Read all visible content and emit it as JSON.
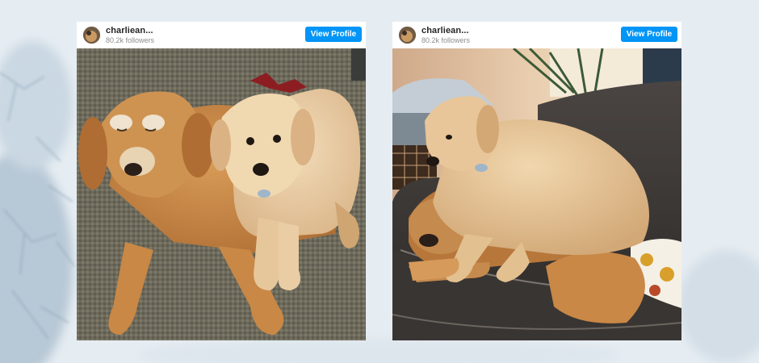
{
  "posts": [
    {
      "username": "charliean...",
      "followers": "80.2k followers",
      "button_label": "View Profile",
      "photo_subject": "senior golden retriever lying next to golden retriever puppy on rug"
    },
    {
      "username": "charliean...",
      "followers": "80.2k followers",
      "button_label": "View Profile",
      "photo_subject": "golden retriever puppy lying on top of senior golden retriever on leather couch"
    }
  ],
  "colors": {
    "button": "#0095f6",
    "background": "#e7eef3",
    "card": "#ffffff"
  }
}
